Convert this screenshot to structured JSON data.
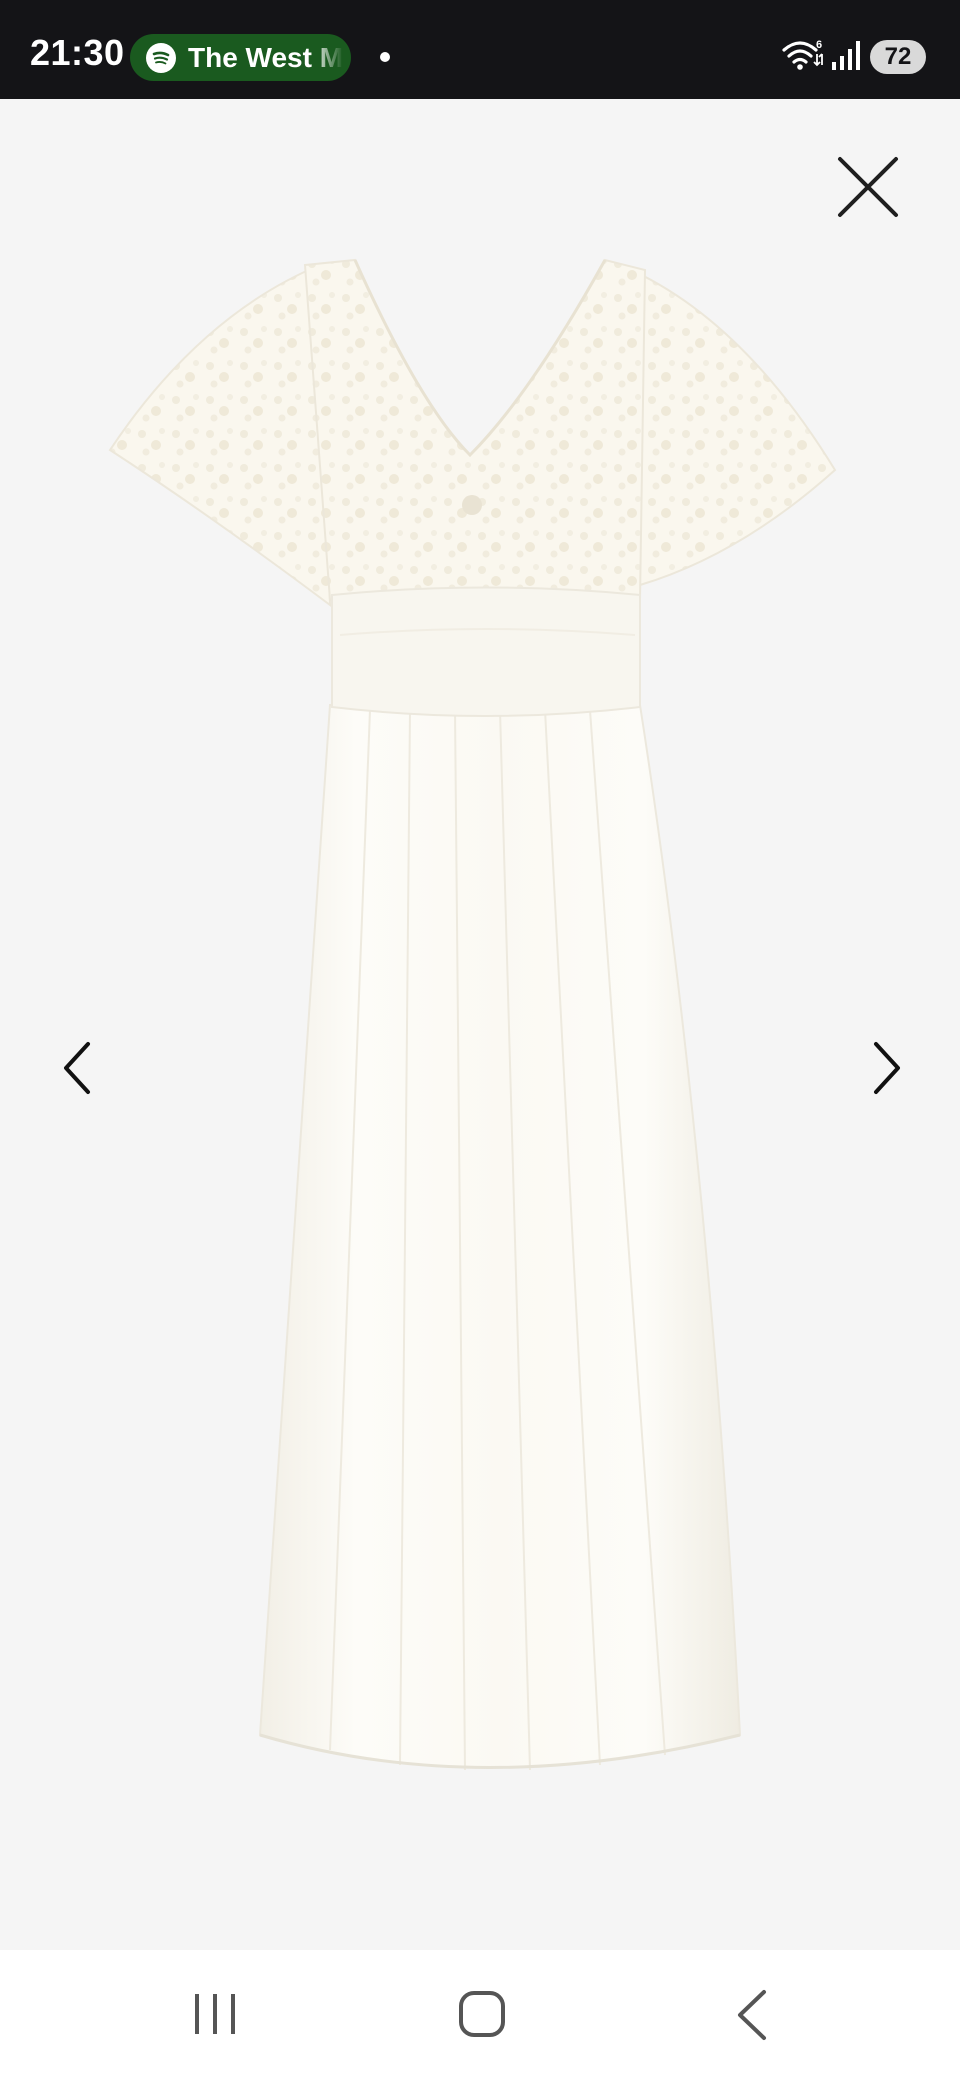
{
  "status_bar": {
    "time": "21:30",
    "media_app_icon": "spotify-icon",
    "media_title": "The West M",
    "battery_level": "72",
    "icons": [
      "wifi-icon",
      "signal-icon",
      "battery-icon"
    ]
  },
  "viewer": {
    "image_subject": "white-maxi-dress",
    "controls": {
      "close_icon": "close-icon",
      "previous_icon": "chevron-left-icon",
      "next_icon": "chevron-right-icon"
    }
  },
  "navigation_bar": {
    "buttons": [
      "recents-icon",
      "home-icon",
      "back-icon"
    ]
  },
  "colors": {
    "status_bar_bg": "#141417",
    "media_pill_bg": "#1a5a1f",
    "viewer_bg": "#f5f5f5",
    "nav_bar_bg": "#ffffff",
    "dress": "#fbf9f3"
  }
}
